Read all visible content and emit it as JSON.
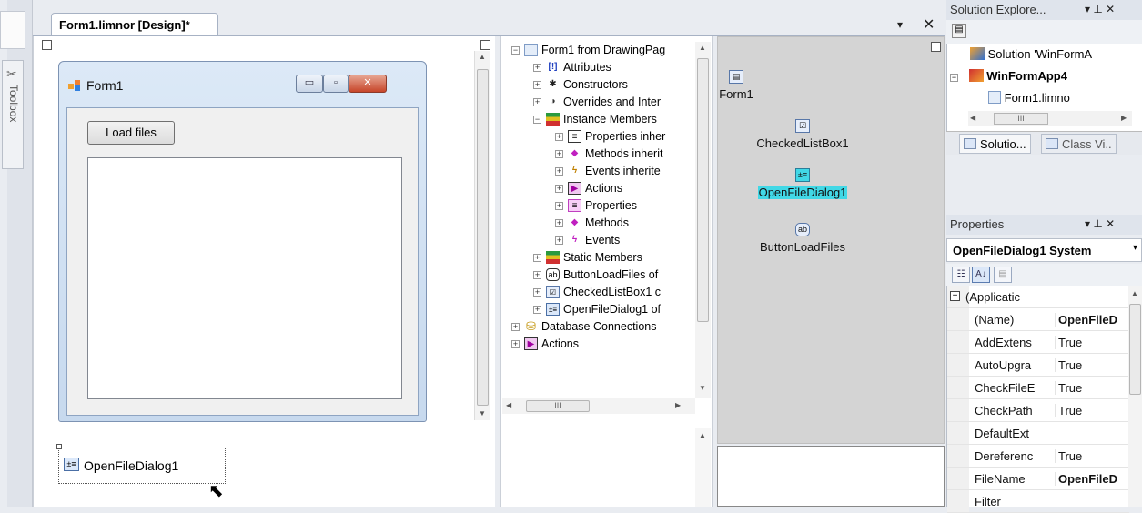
{
  "toolbox": {
    "label": "Toolbox"
  },
  "document_tab": {
    "title": "Form1.limnor [Design]*",
    "dropdown": "▾",
    "close": "✕"
  },
  "form": {
    "title": "Form1",
    "load_button": "Load files",
    "tray_component": "OpenFileDialog1"
  },
  "tree": {
    "items": [
      {
        "label": "Form1 from DrawingPag",
        "exp": "−",
        "icon": "form-icon"
      },
      {
        "label": "Attributes",
        "exp": "+",
        "icon": "attributes-icon"
      },
      {
        "label": "Constructors",
        "exp": "+",
        "icon": "constructors-icon"
      },
      {
        "label": "Overrides and Inter",
        "exp": "+",
        "icon": "overrides-icon"
      },
      {
        "label": "Instance Members",
        "exp": "−",
        "icon": "instance-members-icon"
      },
      {
        "label": "Properties inher",
        "exp": "+",
        "icon": "properties-icon"
      },
      {
        "label": "Methods inherit",
        "exp": "+",
        "icon": "methods-icon"
      },
      {
        "label": "Events inherite",
        "exp": "+",
        "icon": "events-icon"
      },
      {
        "label": "Actions",
        "exp": "+",
        "icon": "actions-icon"
      },
      {
        "label": "Properties",
        "exp": "+",
        "icon": "properties-icon"
      },
      {
        "label": "Methods",
        "exp": "+",
        "icon": "methods-icon"
      },
      {
        "label": "Events",
        "exp": "+",
        "icon": "events-icon"
      },
      {
        "label": "Static Members",
        "exp": "+",
        "icon": "static-members-icon"
      },
      {
        "label": "ButtonLoadFiles of",
        "exp": "+",
        "icon": "button-icon"
      },
      {
        "label": "CheckedListBox1 c",
        "exp": "+",
        "icon": "checkedlistbox-icon"
      },
      {
        "label": "OpenFileDialog1 of",
        "exp": "+",
        "icon": "openfiledialog-icon"
      },
      {
        "label": "Database Connections",
        "exp": "+",
        "icon": "database-icon"
      },
      {
        "label": "Actions",
        "exp": "+",
        "icon": "actions-icon"
      }
    ],
    "hscroll_thumb": "III"
  },
  "components": {
    "form": "Form1",
    "checked_list": "CheckedListBox1",
    "open_file": "OpenFileDialog1",
    "button": "ButtonLoadFiles"
  },
  "solution_explorer": {
    "title": "Solution Explore...",
    "pin": "▾ ⊥ ✕",
    "solution": "Solution 'WinFormA",
    "project": "WinFormApp4",
    "file": "Form1.limno",
    "tab_solution": "Solutio...",
    "tab_class": "Class Vi..",
    "hscroll_thumb": "III"
  },
  "properties": {
    "title": "Properties",
    "pin": "▾ ⊥ ✕",
    "object": "OpenFileDialog1 System",
    "rows": [
      {
        "name": "(Applicatic",
        "value": "",
        "group": true
      },
      {
        "name": "(Name)",
        "value": "OpenFileD",
        "bold_value": true
      },
      {
        "name": "AddExtens",
        "value": "True"
      },
      {
        "name": "AutoUpgra",
        "value": "True"
      },
      {
        "name": "CheckFileE",
        "value": "True"
      },
      {
        "name": "CheckPath",
        "value": "True"
      },
      {
        "name": "DefaultExt",
        "value": ""
      },
      {
        "name": "Dereferenc",
        "value": "True"
      },
      {
        "name": "FileName",
        "value": "OpenFileD",
        "bold_value": true
      },
      {
        "name": "Filter",
        "value": ""
      }
    ]
  }
}
